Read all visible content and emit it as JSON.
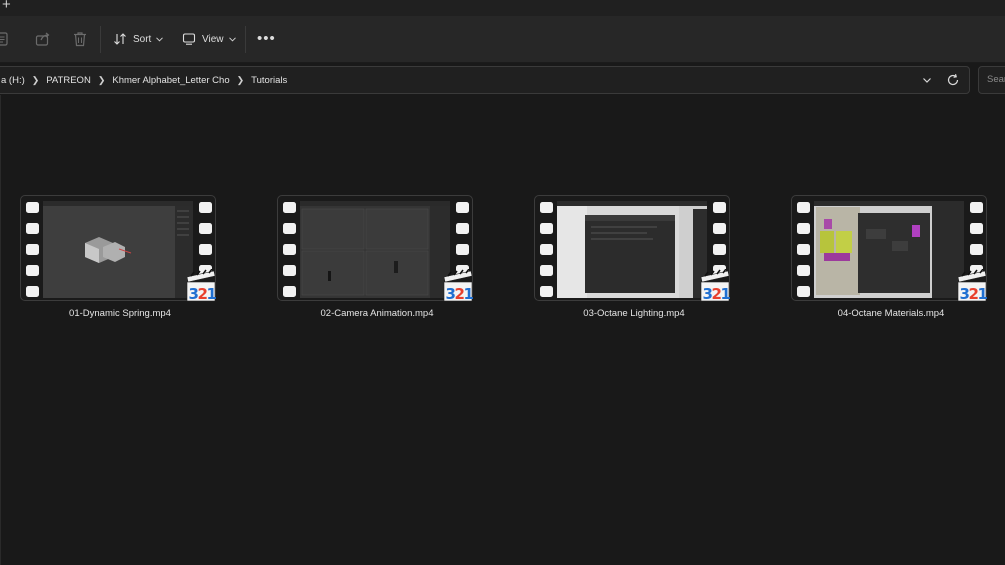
{
  "toolbar": {
    "sort_label": "Sort",
    "view_label": "View",
    "more_label": "•••"
  },
  "address": {
    "crumbs": [
      "a (H:)",
      "PATREON",
      "Khmer Alphabet_Letter Cho",
      "Tutorials"
    ]
  },
  "search": {
    "placeholder": "Sear"
  },
  "files": [
    {
      "name": "01-Dynamic Spring.mp4"
    },
    {
      "name": "02-Camera Animation.mp4"
    },
    {
      "name": "03-Octane Lighting.mp4"
    },
    {
      "name": "04-Octane Materials.mp4"
    }
  ],
  "badge_text": "321",
  "icons": [
    "plus-icon",
    "copy-icon",
    "share-icon",
    "delete-icon",
    "sort-icon",
    "view-icon",
    "chevron-down-icon",
    "refresh-icon"
  ],
  "colors": {
    "background": "#191919",
    "toolbar": "#272727",
    "badge_red": "#e8402d",
    "badge_blue": "#1f6fd1"
  }
}
